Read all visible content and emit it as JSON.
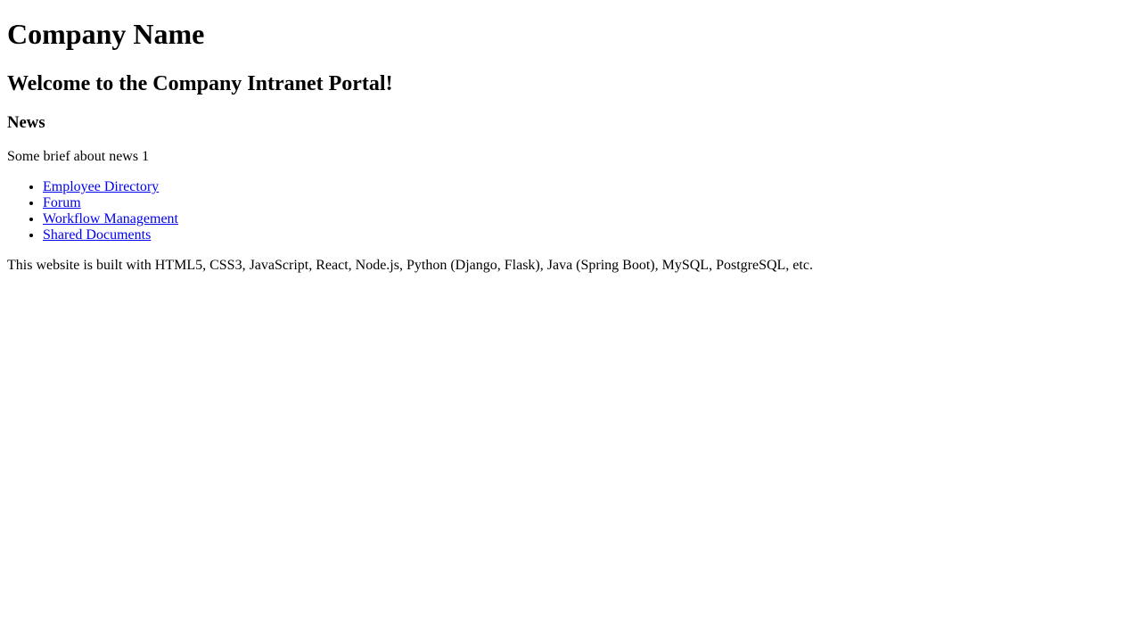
{
  "header": {
    "title": "Company Name"
  },
  "main": {
    "welcome": "Welcome to the Company Intranet Portal!",
    "news": {
      "heading": "News",
      "brief": "Some brief about news 1"
    }
  },
  "nav": {
    "items": [
      {
        "label": "Employee Directory"
      },
      {
        "label": "Forum"
      },
      {
        "label": "Workflow Management"
      },
      {
        "label": "Shared Documents"
      }
    ]
  },
  "footer": {
    "text": "This website is built with HTML5, CSS3, JavaScript, React, Node.js, Python (Django, Flask), Java (Spring Boot), MySQL, PostgreSQL, etc."
  },
  "colors": {
    "link": "#0000ee",
    "text": "#000000",
    "background": "#ffffff"
  }
}
